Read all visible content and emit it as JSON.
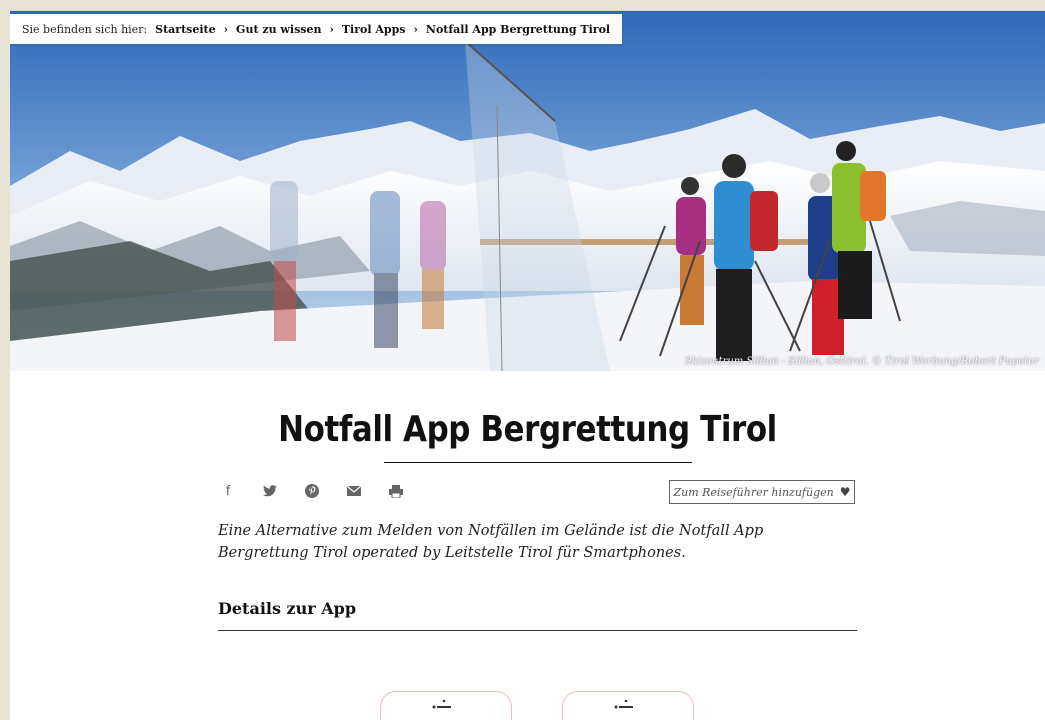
{
  "breadcrumb": {
    "prefix": "Sie befinden sich hier:",
    "items": [
      "Startseite",
      "Gut zu wissen",
      "Tirol Apps",
      "Notfall App Bergrettung Tirol"
    ],
    "separator": "›"
  },
  "hero": {
    "credit": "Skizentrum Sillian - Sillian, Osttirol. © Tirol Werbung/Robert Pupeter"
  },
  "title": "Notfall App Bergrettung Tirol",
  "share": {
    "icons": [
      "facebook-icon",
      "twitter-icon",
      "pinterest-icon",
      "mail-icon",
      "print-icon"
    ],
    "glyphs": [
      "f",
      "🐦",
      "℗",
      "✉",
      "⎙"
    ]
  },
  "guide_button": {
    "label": "Zum Reiseführer hinzufügen",
    "icon": "heart-icon",
    "glyph": "♥"
  },
  "lead": "Eine Alternative zum Melden von Notfällen im Gelände ist die Notfall App Bergrettung Tirol operated by Leitstelle Tirol für Smartphones.",
  "subhead": "Details zur App",
  "colors": {
    "background": "#e9e3d6",
    "sky": "#4a7fc2",
    "phone_border": "#e8c2b6"
  }
}
